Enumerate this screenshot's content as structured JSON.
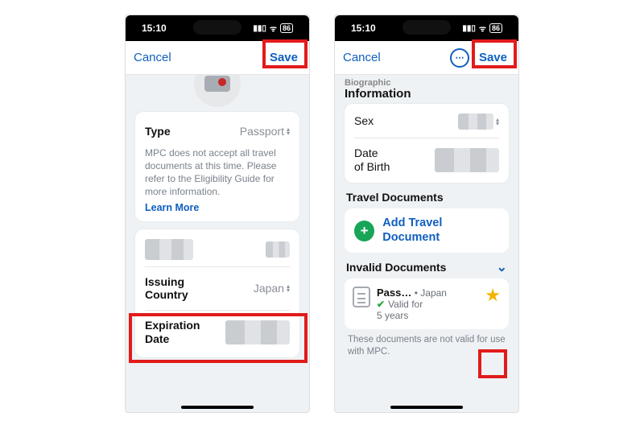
{
  "statusbar": {
    "time": "15:10",
    "battery": "86"
  },
  "left": {
    "nav": {
      "cancel": "Cancel",
      "save": "Save"
    },
    "type": {
      "label": "Type",
      "value": "Passport"
    },
    "helper": "MPC does not accept all travel documents at this time. Please refer to the Eligibility Guide for more information.",
    "learn_more": "Learn More",
    "issuing": {
      "label_line1": "Issuing",
      "label_line2": "Country",
      "value": "Japan"
    },
    "expiration": {
      "label_line1": "Expiration",
      "label_line2": "Date"
    }
  },
  "right": {
    "nav": {
      "cancel": "Cancel",
      "save": "Save"
    },
    "bio_header_line1": "Biographic",
    "bio_header_line2": "Information",
    "sex_label": "Sex",
    "dob_label_line1": "Date",
    "dob_label_line2": "of Birth",
    "travel_docs_header": "Travel Documents",
    "add_doc": "Add Travel Document",
    "invalid_header": "Invalid Documents",
    "doc": {
      "title": "Pass…",
      "sep": "•",
      "country": "Japan",
      "valid_line": "Valid for",
      "valid_years": "5 years"
    },
    "footnote": "These documents are not valid for use with MPC."
  }
}
